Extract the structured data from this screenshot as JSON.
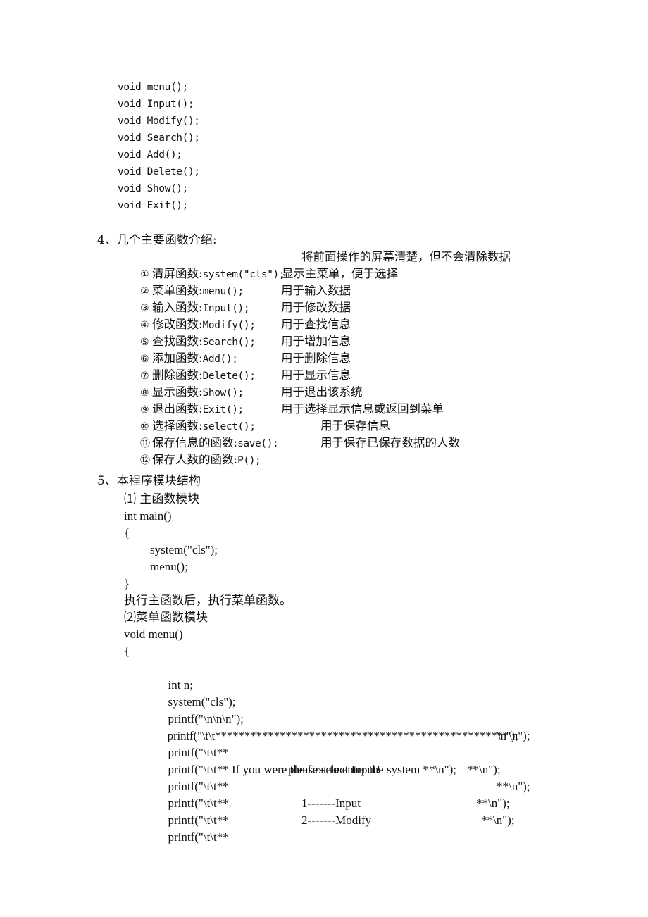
{
  "declarations": [
    "void menu();",
    "void Input();",
    "void Modify();",
    "void Search();",
    "void Add();",
    "void Delete();",
    "void Show();",
    "void Exit();"
  ],
  "section4": {
    "heading": "4、几个主要函数介绍:",
    "items": [
      {
        "num": "①",
        "name": "清屏函数:",
        "call": "system(\"cls\");",
        "desc": "将前面操作的屏幕清楚，但不会清除数据"
      },
      {
        "num": "②",
        "name": "菜单函数:",
        "call": "menu();",
        "desc": "显示主菜单，便于选择"
      },
      {
        "num": "③",
        "name": "输入函数:",
        "call": "Input();",
        "desc": "用于输入数据"
      },
      {
        "num": "④",
        "name": "修改函数:",
        "call": "Modify();",
        "desc": "用于修改数据"
      },
      {
        "num": "⑤",
        "name": "查找函数:",
        "call": "Search();",
        "desc": "用于查找信息"
      },
      {
        "num": "⑥",
        "name": "添加函数:",
        "call": "Add();",
        "desc": "用于增加信息"
      },
      {
        "num": "⑦",
        "name": "删除函数:",
        "call": "Delete();",
        "desc": "用于删除信息"
      },
      {
        "num": "⑧",
        "name": "显示函数:",
        "call": "Show();",
        "desc": "用于显示信息"
      },
      {
        "num": "⑨",
        "name": "退出函数:",
        "call": "Exit();",
        "desc": "用于退出该系统"
      },
      {
        "num": "⑩",
        "name": "选择函数:",
        "call": "select();",
        "desc": "用于选择显示信息或返回到菜单"
      },
      {
        "num": "⑪",
        "name": "保存信息的函数:",
        "call": "save():",
        "desc": "用于保存信息"
      },
      {
        "num": "⑫",
        "name": "保存人数的函数:",
        "call": "P();",
        "desc": "用于保存已保存数据的人数"
      }
    ]
  },
  "section5": {
    "heading": "5、本程序模块结构",
    "sub1_title": "⑴ 主函数模块",
    "main_sig": "int main()",
    "open_brace": "{",
    "main_body": [
      "system(\"cls\");",
      "menu();"
    ],
    "close_brace": "}",
    "main_note": "执行主函数后，执行菜单函数。",
    "sub2_title": "⑵菜单函数模块",
    "menu_sig": "void menu()",
    "menu_open_brace": "{",
    "menu_body": [
      {
        "start": "int n;",
        "mid": "",
        "end": ""
      },
      {
        "start": "system(\"cls\");",
        "mid": "",
        "end": ""
      },
      {
        "start": "printf(\"\\n\\n\\n\");",
        "mid": "",
        "end": ""
      },
      {
        "start": "printf(\"\\t\\t************************************************\\n\");",
        "mid": "",
        "end": ""
      },
      {
        "start": "printf(\"\\t\\t**",
        "mid": "",
        "end": "**\\n\");"
      },
      {
        "start": "printf(\"\\t\\t** If you were the first to enter the system **\\n\");",
        "mid": "",
        "end": ""
      },
      {
        "start": "printf(\"\\t\\t**",
        "mid": "please select Input!",
        "end": "**\\n\");"
      },
      {
        "start": "printf(\"\\t\\t**",
        "mid": "",
        "end": "**\\n\");"
      },
      {
        "start": "printf(\"\\t\\t**",
        "mid": "1-------Input",
        "end": "**\\n\");"
      },
      {
        "start": "printf(\"\\t\\t**",
        "mid": "2-------Modify",
        "end": "**\\n\");"
      }
    ]
  }
}
